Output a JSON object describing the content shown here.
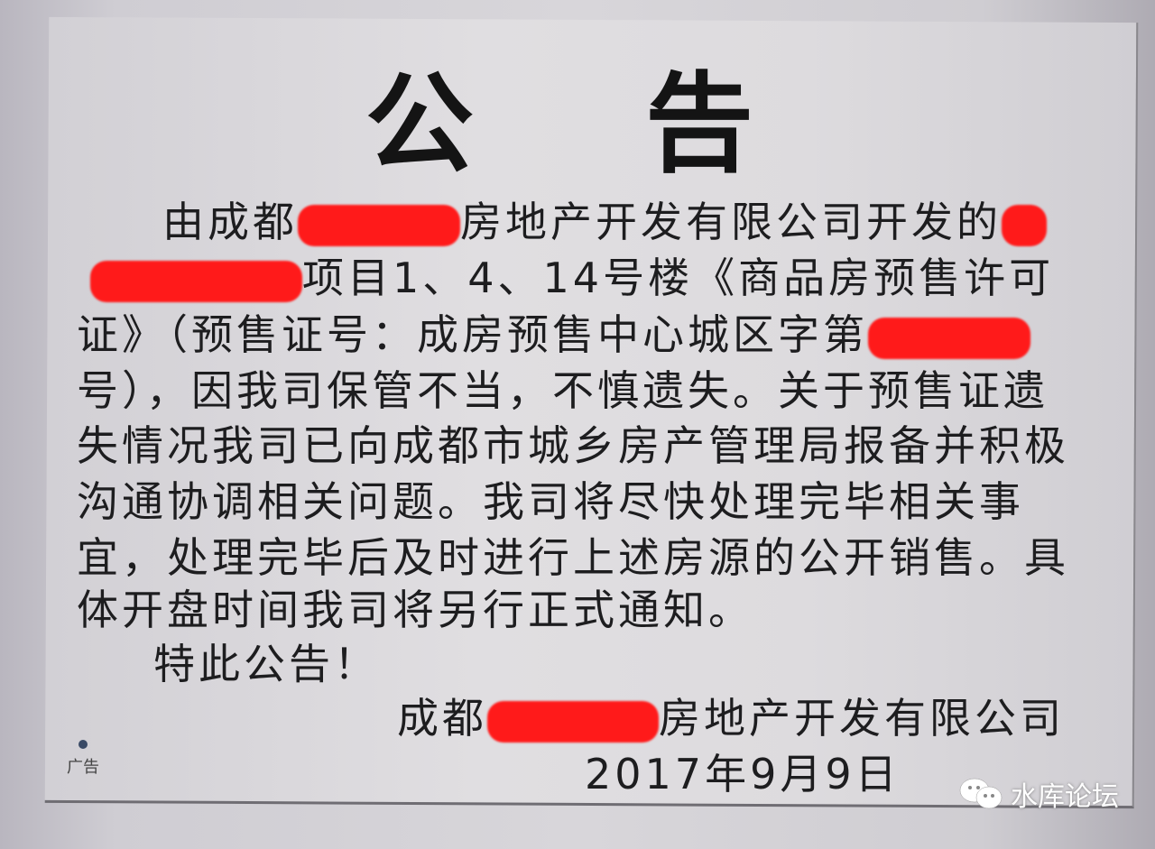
{
  "notice": {
    "title_chars": [
      "公",
      "告"
    ],
    "lines": [
      [
        "由成都",
        "房地产开发有限公司开发的"
      ],
      [
        "项目1、4、14号楼《商品房预售许可"
      ],
      [
        "证》（预售证号：成房预售中心城区字第"
      ],
      [
        "号），因我司保管不当，不慎遗失。关于预售证遗"
      ],
      [
        "失情况我司已向成都市城乡房产管理局报备并积极"
      ],
      [
        "沟通协调相关问题。我司将尽快处理完毕相关事"
      ],
      [
        "宜，处理完毕后及时进行上述房源的公开销售。具"
      ],
      [
        "体开盘时间我司将另行正式通知。"
      ],
      [
        "特此公告！"
      ]
    ],
    "signature": [
      "成都",
      "房地产开发有限公司"
    ],
    "date": "2017年9月9日",
    "redaction_color": "#ff1a1a"
  },
  "ad_label": "广告",
  "watermark": {
    "icon": "wechat-icon",
    "text": "水库论坛"
  }
}
